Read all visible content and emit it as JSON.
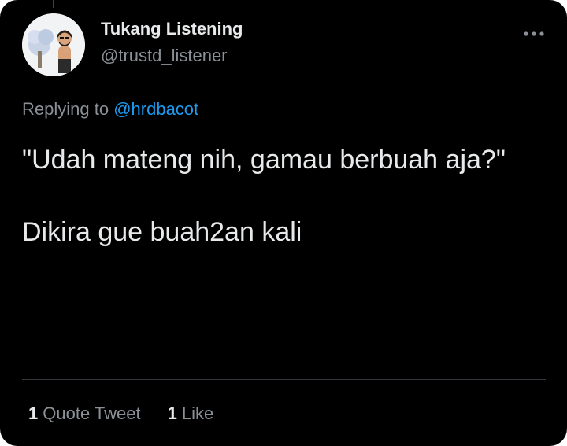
{
  "tweet": {
    "author": {
      "display_name": "Tukang Listening",
      "handle": "@trustd_listener"
    },
    "reply": {
      "prefix": "Replying to",
      "mention": "@hrdbacot"
    },
    "text_paragraphs": [
      "\"Udah mateng nih, gamau berbuah aja?\"",
      "Dikira gue buah2an kali"
    ],
    "stats": {
      "quote_count": "1",
      "quote_label": "Quote Tweet",
      "like_count": "1",
      "like_label": "Like"
    }
  },
  "icons": {
    "more": "more-options-icon",
    "avatar": "bitmoji-avatar"
  },
  "colors": {
    "background": "#000000",
    "primary_text": "#e7e9ea",
    "secondary_text": "#8b9096",
    "link": "#1d9bf0",
    "divider": "#33363a"
  }
}
